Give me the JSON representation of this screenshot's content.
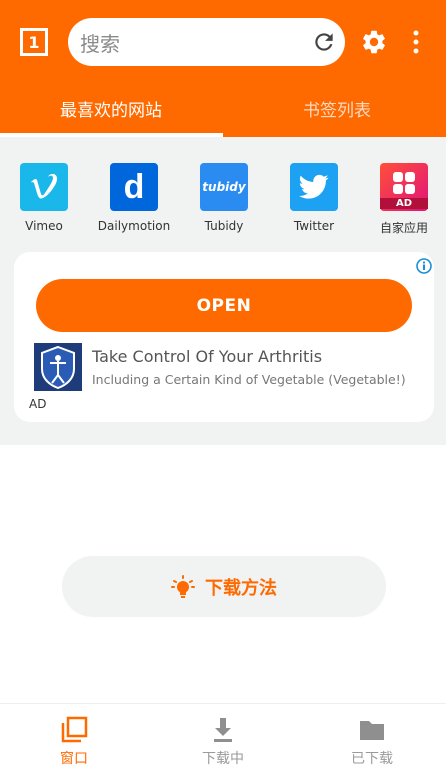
{
  "header": {
    "tab_count": "1",
    "search_placeholder": "搜索",
    "tabs": [
      {
        "label": "最喜欢的网站"
      },
      {
        "label": "书签列表"
      }
    ]
  },
  "sites": [
    {
      "label": "Vimeo",
      "icon": "vimeo-icon",
      "color": "#1ab7ea"
    },
    {
      "label": "Dailymotion",
      "icon": "dailymotion-icon",
      "color": "#0066dc"
    },
    {
      "label": "Tubidy",
      "icon": "tubidy-icon",
      "color": "#2a8cf0",
      "glyph": "tubidy"
    },
    {
      "label": "Twitter",
      "icon": "twitter-icon",
      "color": "#1da1f2"
    },
    {
      "label": "自家应用",
      "icon": "house-app-icon",
      "color": "#f2294b",
      "badge": "AD"
    }
  ],
  "ad": {
    "button_label": "OPEN",
    "title": "Take Control Of Your Arthritis",
    "subtitle": "Including a Certain Kind of Vegetable (Vegetable!)",
    "label": "AD"
  },
  "howto": {
    "label": "下载方法"
  },
  "bottom_nav": [
    {
      "label": "窗口",
      "icon": "windows-icon",
      "active": true
    },
    {
      "label": "下载中",
      "icon": "download-icon",
      "active": false
    },
    {
      "label": "已下载",
      "icon": "folder-icon",
      "active": false
    }
  ],
  "colors": {
    "accent": "#ff6a00",
    "background": "#f1f2f2"
  }
}
